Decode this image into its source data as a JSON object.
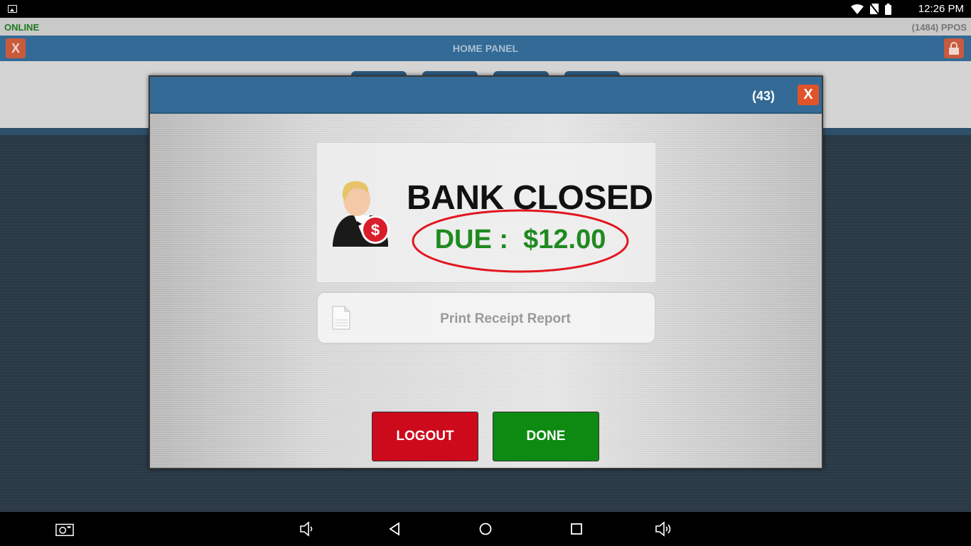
{
  "status_bar": {
    "time": "12:26 PM",
    "icons": [
      "image-notification-icon",
      "wifi-icon",
      "no-sim-icon",
      "battery-icon"
    ]
  },
  "app": {
    "connection_status": "ONLINE",
    "station_label": "(1484) PPOS",
    "header_title": "HOME PANEL",
    "close_label": "X",
    "colors": {
      "header": "#336a96",
      "online": "#1f7a1f",
      "danger": "#cc0a1c",
      "success": "#0d8a12"
    }
  },
  "modal": {
    "count": "(43)",
    "close_label": "X",
    "title": "BANK CLOSED",
    "due_label": "DUE :  $12.00",
    "print_label": "Print Receipt Report",
    "logout_label": "LOGOUT",
    "done_label": "DONE",
    "avatar_badge": "$"
  },
  "nav_bar": {
    "icons": [
      "screenshot-icon",
      "volume-down-icon",
      "back-icon",
      "home-icon",
      "recents-icon",
      "volume-up-icon"
    ]
  }
}
